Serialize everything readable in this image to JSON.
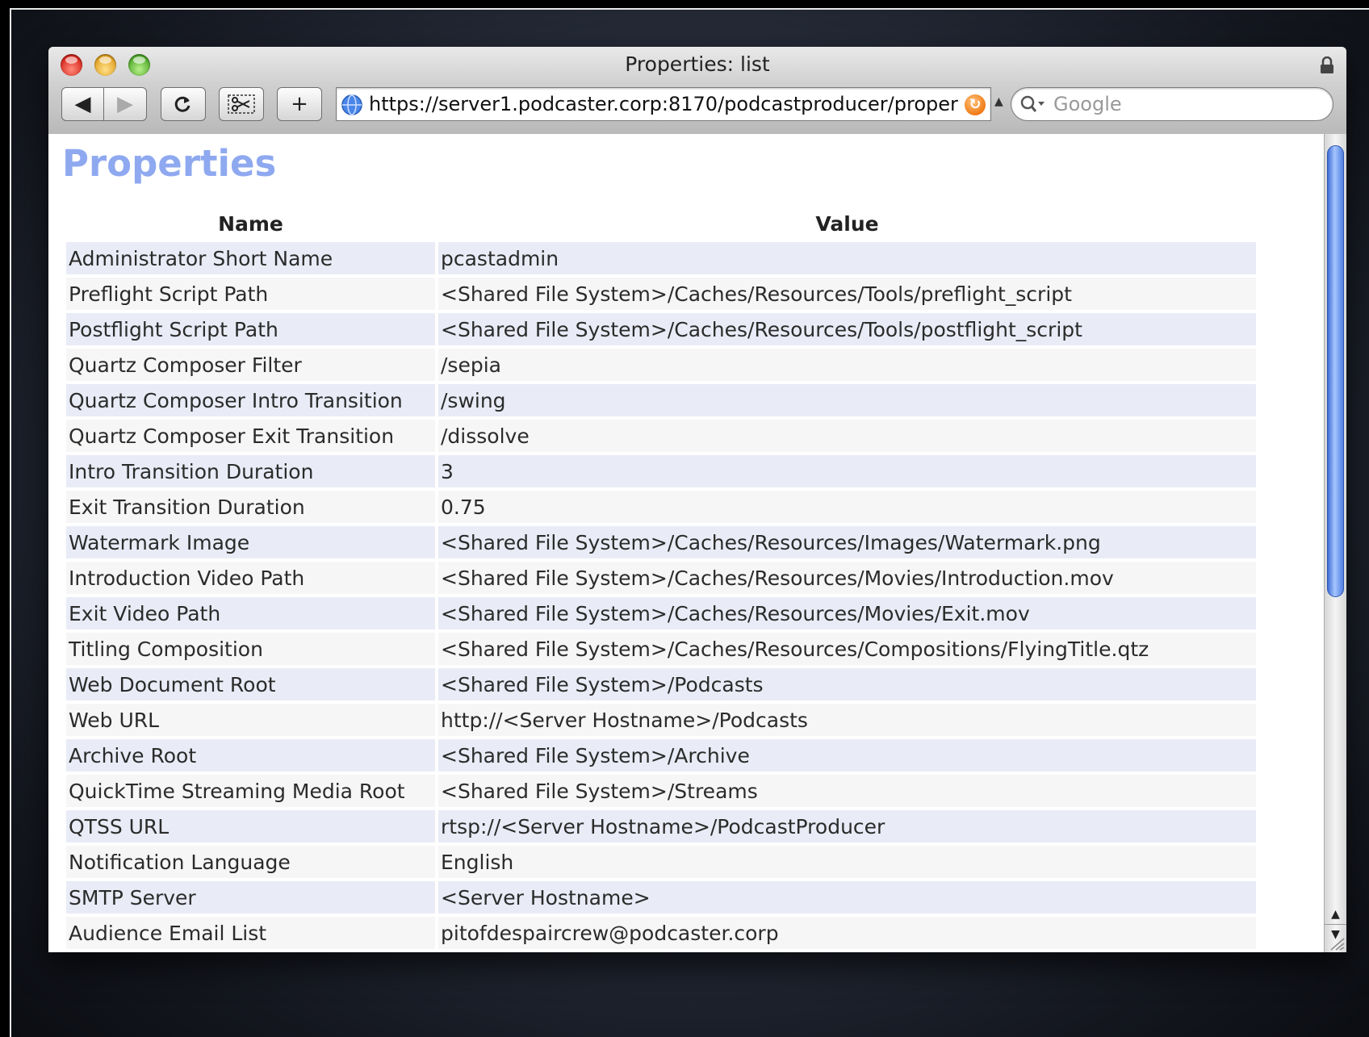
{
  "window": {
    "title": "Properties: list"
  },
  "toolbar": {
    "back_icon": "◀",
    "forward_icon": "▶",
    "add_label": "+"
  },
  "address": {
    "url": "https://server1.podcaster.corp:8170/podcastproducer/proper"
  },
  "search": {
    "placeholder": "Google"
  },
  "page": {
    "title": "Properties",
    "columns": [
      "Name",
      "Value"
    ],
    "rows": [
      {
        "name": "Administrator Short Name",
        "value": "pcastadmin"
      },
      {
        "name": "Preflight Script Path",
        "value": "<Shared File System>/Caches/Resources/Tools/preflight_script"
      },
      {
        "name": "Postflight Script Path",
        "value": "<Shared File System>/Caches/Resources/Tools/postflight_script"
      },
      {
        "name": "Quartz Composer Filter",
        "value": "/sepia"
      },
      {
        "name": "Quartz Composer Intro Transition",
        "value": "/swing"
      },
      {
        "name": "Quartz Composer Exit Transition",
        "value": "/dissolve"
      },
      {
        "name": "Intro Transition Duration",
        "value": "3"
      },
      {
        "name": "Exit Transition Duration",
        "value": "0.75"
      },
      {
        "name": "Watermark Image",
        "value": "<Shared File System>/Caches/Resources/Images/Watermark.png"
      },
      {
        "name": "Introduction Video Path",
        "value": "<Shared File System>/Caches/Resources/Movies/Introduction.mov"
      },
      {
        "name": "Exit Video Path",
        "value": "<Shared File System>/Caches/Resources/Movies/Exit.mov"
      },
      {
        "name": "Titling Composition",
        "value": "<Shared File System>/Caches/Resources/Compositions/FlyingTitle.qtz"
      },
      {
        "name": "Web Document Root",
        "value": "<Shared File System>/Podcasts"
      },
      {
        "name": "Web URL",
        "value": "http://<Server Hostname>/Podcasts"
      },
      {
        "name": "Archive Root",
        "value": "<Shared File System>/Archive"
      },
      {
        "name": "QuickTime Streaming Media Root",
        "value": "<Shared File System>/Streams"
      },
      {
        "name": "QTSS URL",
        "value": "rtsp://<Server Hostname>/PodcastProducer"
      },
      {
        "name": "Notification Language",
        "value": "English"
      },
      {
        "name": "SMTP Server",
        "value": "<Server Hostname>"
      },
      {
        "name": "Audience Email List",
        "value": "pitofdespaircrew@podcaster.corp"
      }
    ]
  },
  "colors": {
    "title_blue": "#8fa9f0",
    "row_odd": "#e9ecf6",
    "row_even": "#f6f6f6"
  }
}
